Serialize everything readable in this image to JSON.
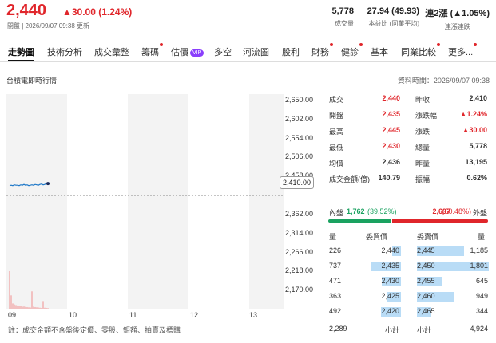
{
  "header": {
    "price": "2,440",
    "change": "▲30.00 (1.24%)",
    "meta": "開盤 | 2026/09/07 09:38 更新",
    "stats": [
      {
        "value": "5,778",
        "label": "成交量"
      },
      {
        "value": "27.94 (49.93)",
        "label": "本益比 (同業平均)"
      },
      {
        "value": "連2漲 (▲1.05%)",
        "label": "連漲連跌"
      }
    ]
  },
  "tabs": [
    "走勢圖",
    "技術分析",
    "成交彙整",
    "籌碼",
    "估價",
    "多空",
    "河流圖",
    "股利",
    "財務",
    "健診",
    "基本",
    "同業比較",
    "更多..."
  ],
  "vip_label": "VIP",
  "sub": {
    "title": "台積電即時行情",
    "time": "資料時間：2026/09/07 09:38"
  },
  "chart_data": {
    "type": "line",
    "ylim": [
      2122,
      2666
    ],
    "yticks": [
      "2,650.00",
      "2,602.00",
      "2,554.00",
      "2,506.00",
      "2,458.00",
      "2,410.00",
      "2,362.00",
      "2,314.00",
      "2,266.00",
      "2,218.00",
      "2,170.00"
    ],
    "ytick_values": [
      2650,
      2602,
      2554,
      2506,
      2458,
      2410,
      2362,
      2314,
      2266,
      2218,
      2170
    ],
    "reference": 2410,
    "reference_label": "2,410.00",
    "xticks": [
      "09",
      "10",
      "11",
      "12",
      "13"
    ],
    "price_series": [
      2435,
      2436,
      2435,
      2437,
      2436,
      2436,
      2435,
      2437,
      2436,
      2438,
      2436,
      2437,
      2435,
      2436,
      2437,
      2436,
      2438,
      2437,
      2436,
      2438,
      2439,
      2437,
      2438,
      2440,
      2440
    ],
    "volume_series": [
      1900,
      700,
      300,
      250,
      220,
      200,
      180,
      160,
      140,
      150,
      130,
      120,
      110,
      100,
      900,
      140,
      120,
      110,
      100,
      90,
      80,
      420,
      90,
      80,
      70
    ],
    "note": "註：成交金額不含盤後定價、零股、鉅額、拍賣及標購"
  },
  "quote": [
    [
      "成交",
      "2,440",
      "昨收",
      "2,410"
    ],
    [
      "開盤",
      "2,435",
      "漲跌幅",
      "▲1.24%"
    ],
    [
      "最高",
      "2,445",
      "漲跌",
      "▲30.00"
    ],
    [
      "最低",
      "2,430",
      "總量",
      "5,778"
    ],
    [
      "均價",
      "2,436",
      "昨量",
      "13,195"
    ],
    [
      "成交金額(億)",
      "140.79",
      "振幅",
      "0.62%"
    ]
  ],
  "inner_outer": {
    "inner_label": "內盤",
    "inner_value": "1,762",
    "inner_pct": "(39.52%)",
    "outer_value": "2,697",
    "outer_pct": "(60.48%)",
    "outer_label": "外盤",
    "inner_ratio": 0.3952
  },
  "orderbook": {
    "headers": [
      "量",
      "委買價",
      "委賣價",
      "量"
    ],
    "bids": [
      {
        "vol": "226",
        "price": "2,440",
        "n": 226
      },
      {
        "vol": "737",
        "price": "2,435",
        "n": 737
      },
      {
        "vol": "471",
        "price": "2,430",
        "n": 471
      },
      {
        "vol": "363",
        "price": "2,425",
        "n": 363
      },
      {
        "vol": "492",
        "price": "2,420",
        "n": 492
      }
    ],
    "asks": [
      {
        "price": "2,445",
        "vol": "1,185",
        "n": 1185
      },
      {
        "price": "2,450",
        "vol": "1,801",
        "n": 1801
      },
      {
        "price": "2,455",
        "vol": "645",
        "n": 645
      },
      {
        "price": "2,460",
        "vol": "949",
        "n": 949
      },
      {
        "price": "2,465",
        "vol": "344",
        "n": 344
      }
    ],
    "bid_total": "2,289",
    "subtotal_label": "小計",
    "ask_total": "4,924"
  },
  "colors": {
    "up": "#e0262b",
    "down": "#1aa260",
    "line": "#1f78c8",
    "bar": "#b9dcf6",
    "volume": "#f2a0a0"
  }
}
